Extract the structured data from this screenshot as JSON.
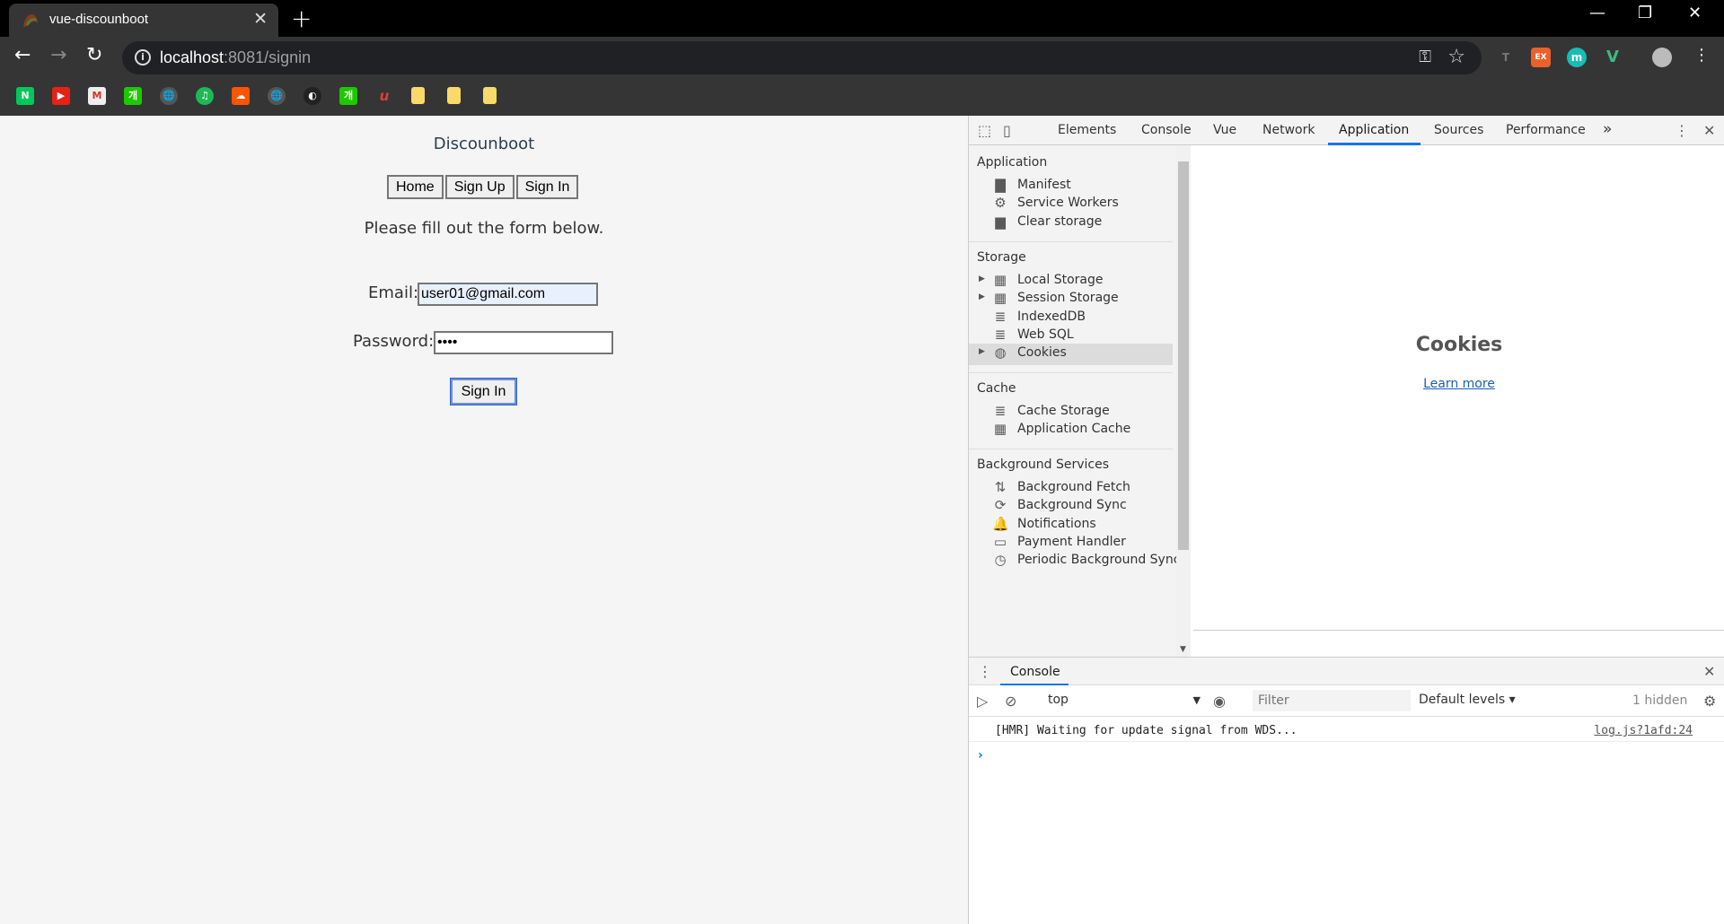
{
  "browser": {
    "tab_title": "vue-discounboot",
    "tab_close": "✕",
    "new_tab": "+",
    "url_host": "localhost",
    "url_rest": ":8081/signin",
    "window_controls": {
      "minimize": "—",
      "restore": "❐",
      "close": "✕"
    },
    "extensions": [
      "T",
      "EX",
      "m",
      "V"
    ],
    "bookmarks": [
      "N",
      "▶",
      "M",
      "개",
      "🌐",
      "♫",
      "☁",
      "🌐",
      "◐",
      "개",
      "u",
      "",
      "",
      ""
    ]
  },
  "page": {
    "site_title": "Discounboot",
    "nav": [
      "Home",
      "Sign Up",
      "Sign In"
    ],
    "instructions": "Please fill out the form below.",
    "email_label": "Email:",
    "email_value": "user01@gmail.com",
    "password_label": "Password:",
    "password_value": "••••",
    "submit_label": "Sign In"
  },
  "devtools": {
    "tabs": [
      "Elements",
      "Console",
      "Vue",
      "Network",
      "Application",
      "Sources",
      "Performance"
    ],
    "active_tab": "Application",
    "overflow": "»",
    "sections": {
      "application": {
        "title": "Application",
        "items": [
          "Manifest",
          "Service Workers",
          "Clear storage"
        ]
      },
      "storage": {
        "title": "Storage",
        "items": [
          "Local Storage",
          "Session Storage",
          "IndexedDB",
          "Web SQL",
          "Cookies"
        ]
      },
      "cache": {
        "title": "Cache",
        "items": [
          "Cache Storage",
          "Application Cache"
        ]
      },
      "background": {
        "title": "Background Services",
        "items": [
          "Background Fetch",
          "Background Sync",
          "Notifications",
          "Payment Handler",
          "Periodic Background Sync"
        ]
      }
    },
    "selected_item": "Cookies",
    "main_title": "Cookies",
    "learn_more": "Learn more",
    "drawer_tab": "Console",
    "context": "top",
    "filter_placeholder": "Filter",
    "levels": "Default levels ▾",
    "hidden": "1 hidden",
    "message": "[HMR] Waiting for update signal from WDS...",
    "message_source": "log.js?1afd:24",
    "prompt": "›"
  }
}
